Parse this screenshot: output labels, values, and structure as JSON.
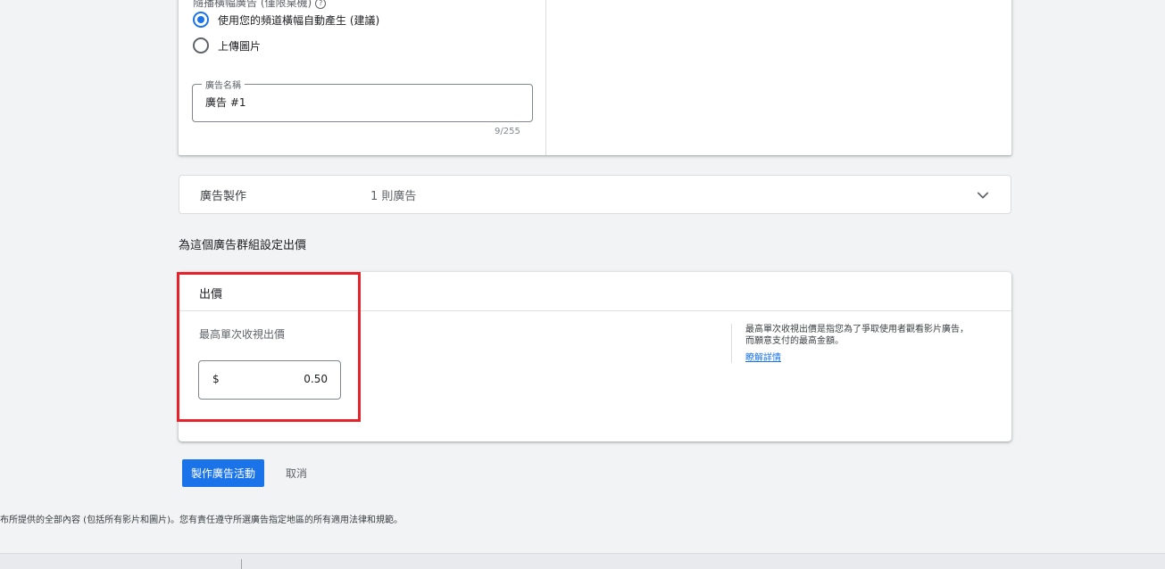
{
  "top_card": {
    "cut_label": "隨播橫幅廣告 (僅限桌機)",
    "radios": [
      {
        "label": "使用您的頻道橫幅自動產生 (建議)",
        "checked": true
      },
      {
        "label": "上傳圖片",
        "checked": false
      }
    ],
    "ad_name": {
      "legend": "廣告名稱",
      "value": "廣告 #1",
      "counter": "9/255"
    }
  },
  "ad_production": {
    "title": "廣告製作",
    "count": "1 則廣告"
  },
  "section_title": "為這個廣告群組設定出價",
  "bid": {
    "header": "出價",
    "label": "最高單次收視出價",
    "currency": "$",
    "value": "0.50",
    "help_text": "最高單次收視出價是指您為了爭取使用者觀看影片廣告，而願意支付的最高金額。",
    "learn_more": "瞭解詳情"
  },
  "actions": {
    "create": "製作廣告活動",
    "cancel": "取消"
  },
  "footer_note": "布所提供的全部內容 (包括所有影片和圖片)。您有責任遵守所選廣告指定地區的所有適用法律和規範。",
  "colors": {
    "accent": "#1a73e8",
    "highlight": "#e8222b"
  }
}
